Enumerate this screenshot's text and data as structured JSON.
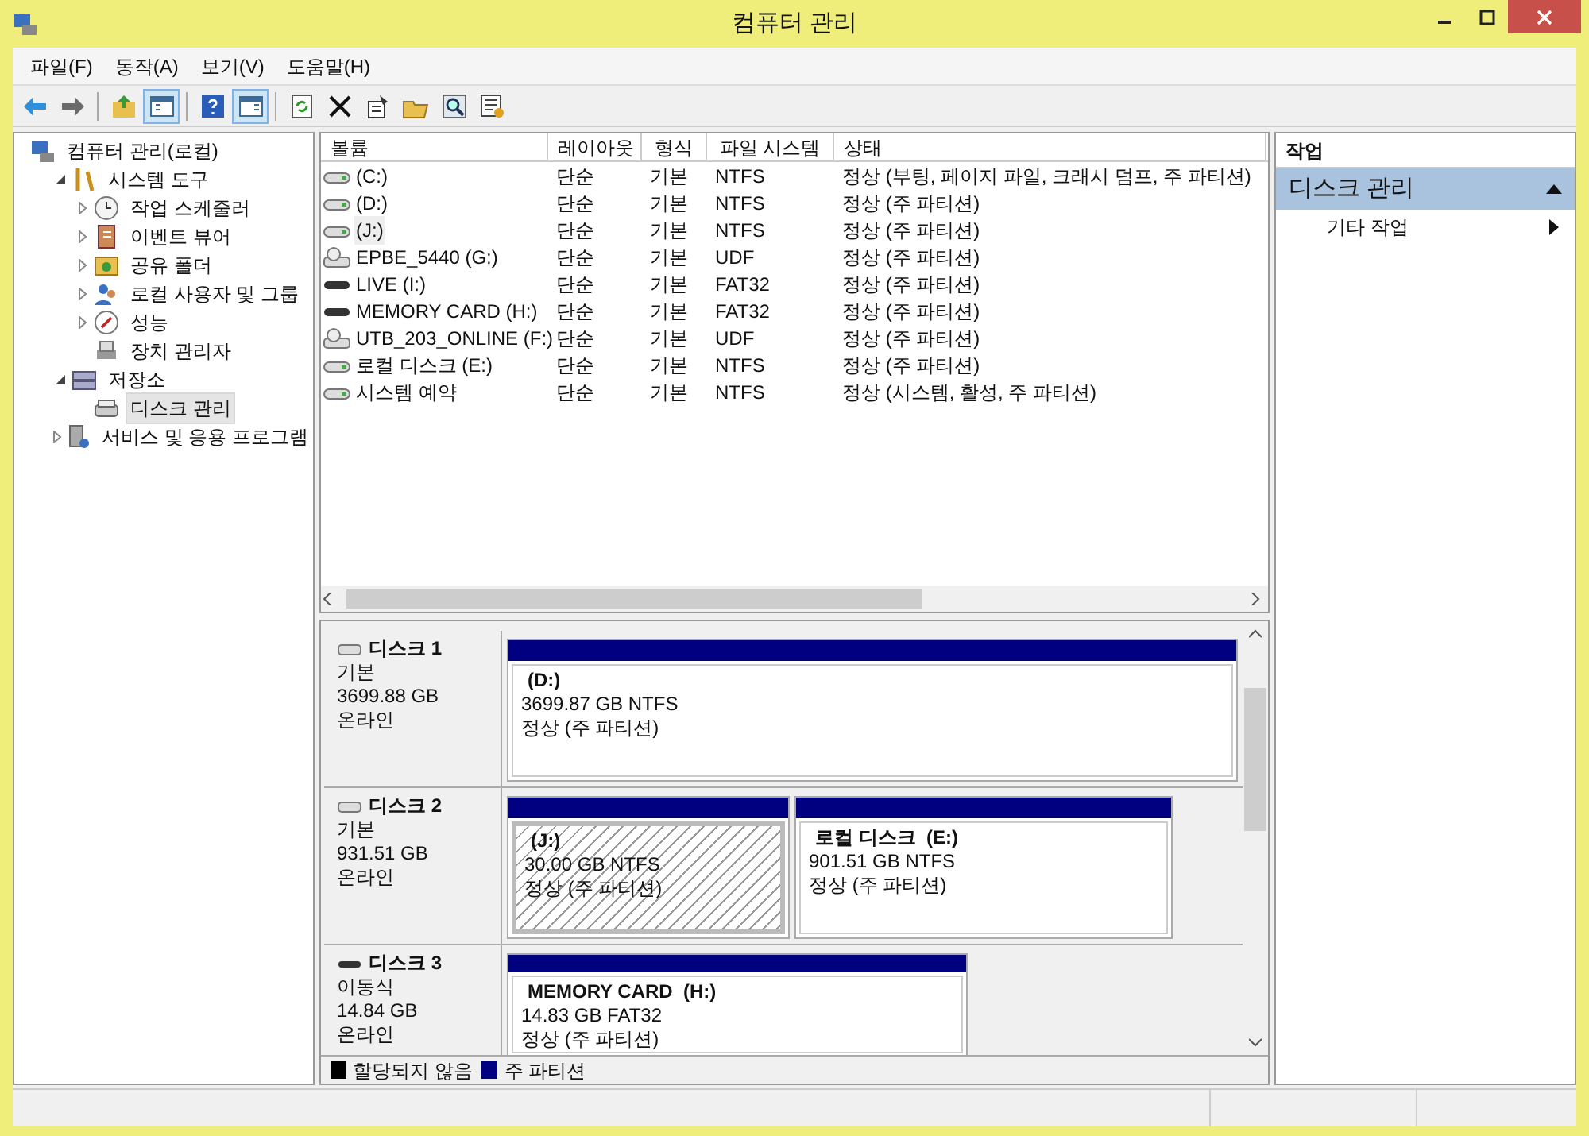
{
  "window": {
    "title": "컴퓨터 관리"
  },
  "menu": [
    "파일(F)",
    "동작(A)",
    "보기(V)",
    "도움말(H)"
  ],
  "toolbar": [
    [
      {
        "kind": "back",
        "pressed": false
      },
      {
        "kind": "forward",
        "pressed": false
      }
    ],
    [
      {
        "kind": "up",
        "pressed": false
      },
      {
        "kind": "tree",
        "pressed": true
      }
    ],
    [
      {
        "kind": "help",
        "pressed": false
      },
      {
        "kind": "pane",
        "pressed": true
      }
    ],
    [
      {
        "kind": "refresh",
        "pressed": false
      },
      {
        "kind": "delete",
        "pressed": false
      },
      {
        "kind": "properties",
        "pressed": false
      },
      {
        "kind": "open",
        "pressed": false
      },
      {
        "kind": "search",
        "pressed": false
      },
      {
        "kind": "settings",
        "pressed": false
      }
    ]
  ],
  "tree": [
    {
      "label": "컴퓨터 관리(로컬)",
      "kind": "root",
      "selected": false,
      "children": [
        {
          "label": "시스템 도구",
          "kind": "node",
          "expanded": true,
          "selected": false,
          "children": [
            {
              "label": "작업 스케줄러",
              "kind": "node",
              "expanded": false,
              "selected": false
            },
            {
              "label": "이벤트 뷰어",
              "kind": "node",
              "expanded": false,
              "selected": false
            },
            {
              "label": "공유 폴더",
              "kind": "node",
              "expanded": false,
              "selected": false
            },
            {
              "label": "로컬 사용자 및 그룹",
              "kind": "node",
              "expanded": false,
              "selected": false
            },
            {
              "label": "성능",
              "kind": "node",
              "expanded": false,
              "selected": false
            },
            {
              "label": "장치 관리자",
              "kind": "leaf",
              "selected": false
            }
          ]
        },
        {
          "label": "저장소",
          "kind": "node",
          "expanded": true,
          "selected": false,
          "children": [
            {
              "label": "디스크 관리",
              "kind": "leaf",
              "selected": true
            }
          ]
        },
        {
          "label": "서비스 및 응용 프로그램",
          "kind": "node",
          "expanded": false,
          "selected": false
        }
      ]
    }
  ],
  "volumes": {
    "columns": [
      "볼륨",
      "레이아웃",
      "형식",
      "파일 시스템",
      "상태"
    ],
    "rows": [
      {
        "kind": "hdd",
        "selected": false,
        "cells": [
          "(C:)",
          "단순",
          "기본",
          "NTFS",
          "정상 (부팅, 페이지 파일, 크래시 덤프, 주 파티션)"
        ]
      },
      {
        "kind": "hdd",
        "selected": false,
        "cells": [
          "(D:)",
          "단순",
          "기본",
          "NTFS",
          "정상 (주 파티션)"
        ]
      },
      {
        "kind": "hdd",
        "selected": true,
        "cells": [
          "(J:)",
          "단순",
          "기본",
          "NTFS",
          "정상 (주 파티션)"
        ]
      },
      {
        "kind": "optical",
        "selected": false,
        "cells": [
          "EPBE_5440 (G:)",
          "단순",
          "기본",
          "UDF",
          "정상 (주 파티션)"
        ]
      },
      {
        "kind": "removable",
        "selected": false,
        "cells": [
          "LIVE (I:)",
          "단순",
          "기본",
          "FAT32",
          "정상 (주 파티션)"
        ]
      },
      {
        "kind": "removable",
        "selected": false,
        "cells": [
          "MEMORY CARD (H:)",
          "단순",
          "기본",
          "FAT32",
          "정상 (주 파티션)"
        ]
      },
      {
        "kind": "optical",
        "selected": false,
        "cells": [
          "UTB_203_ONLINE (F:)",
          "단순",
          "기본",
          "UDF",
          "정상 (주 파티션)"
        ]
      },
      {
        "kind": "hdd",
        "selected": false,
        "cells": [
          "로컬 디스크 (E:)",
          "단순",
          "기본",
          "NTFS",
          "정상 (주 파티션)"
        ]
      },
      {
        "kind": "hdd",
        "selected": false,
        "cells": [
          "시스템 예약",
          "단순",
          "기본",
          "NTFS",
          "정상 (시스템, 활성, 주 파티션)"
        ]
      }
    ]
  },
  "disks": [
    {
      "name": "디스크 1",
      "kind": "fixed",
      "info": [
        "기본",
        "3699.88 GB",
        "온라인"
      ],
      "partitions": [
        {
          "name": "(D:)",
          "size": "3699.87 GB NTFS",
          "status": "정상 (주 파티션)",
          "selected": false
        }
      ]
    },
    {
      "name": "디스크 2",
      "kind": "fixed",
      "info": [
        "기본",
        "931.51 GB",
        "온라인"
      ],
      "partitions": [
        {
          "name": "(J:)",
          "size": "30.00 GB NTFS",
          "status": "정상 (주 파티션)",
          "selected": true
        },
        {
          "name": "로컬 디스크  (E:)",
          "size": "901.51 GB NTFS",
          "status": "정상 (주 파티션)",
          "selected": false
        }
      ]
    },
    {
      "name": "디스크 3",
      "kind": "removable",
      "info": [
        "이동식",
        "14.84 GB",
        "온라인"
      ],
      "partitions": [
        {
          "name": "MEMORY CARD  (H:)",
          "size": "14.83 GB FAT32",
          "status": "정상 (주 파티션)",
          "selected": false
        }
      ]
    }
  ],
  "legend": [
    {
      "label": "할당되지 않음",
      "color": "#000000"
    },
    {
      "label": "주 파티션",
      "color": "#000080"
    }
  ],
  "actions": {
    "title": "작업",
    "sections": [
      {
        "label": "디스크 관리",
        "expanded": true,
        "items": [
          "기타 작업"
        ]
      }
    ]
  }
}
